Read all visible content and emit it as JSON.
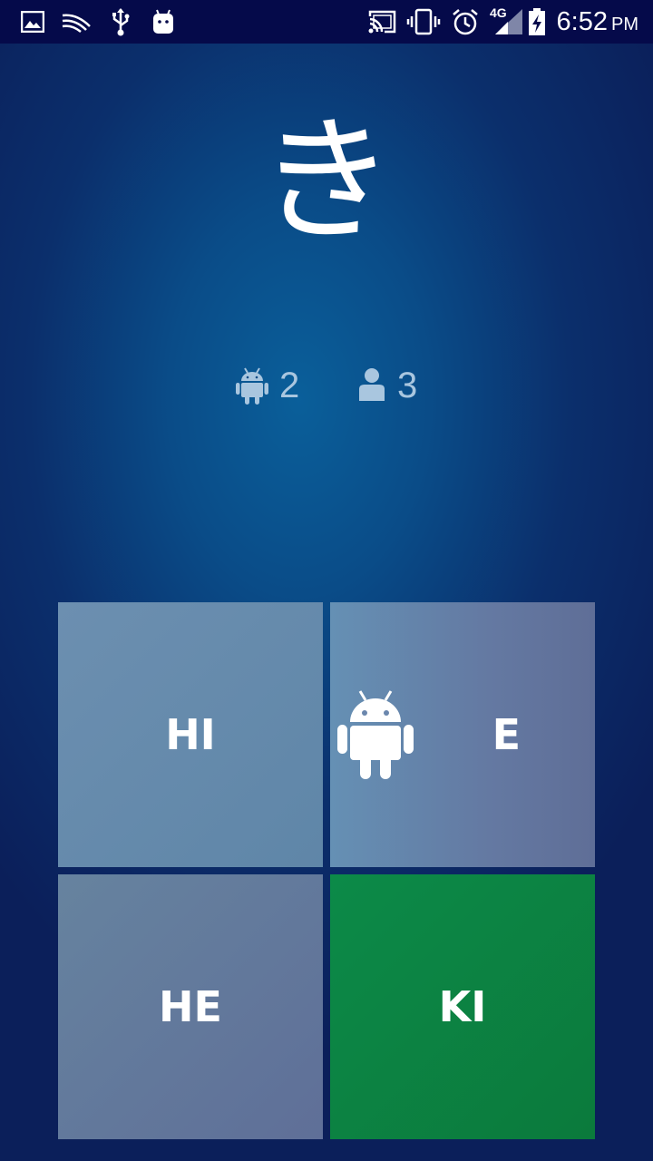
{
  "status_bar": {
    "network": "4G",
    "time": "6:52",
    "ampm": "PM",
    "icons": [
      "gallery-icon",
      "swiftkey-icon",
      "usb-icon",
      "android-debug-icon",
      "cast-icon",
      "vibrate-icon",
      "alarm-icon",
      "signal-icon",
      "battery-charging-icon"
    ]
  },
  "question": {
    "kana": "き"
  },
  "scores": {
    "computer": {
      "icon": "android-icon",
      "value": "2"
    },
    "player": {
      "icon": "person-icon",
      "value": "3"
    }
  },
  "answers": [
    {
      "label": "HI"
    },
    {
      "label": "E",
      "marker": "android-icon"
    },
    {
      "label": "HE"
    },
    {
      "label": "KI",
      "state": "correct"
    }
  ],
  "colors": {
    "correct": "#0c8a48",
    "tile": "#6588ac",
    "status_bar": "#050a4a"
  }
}
